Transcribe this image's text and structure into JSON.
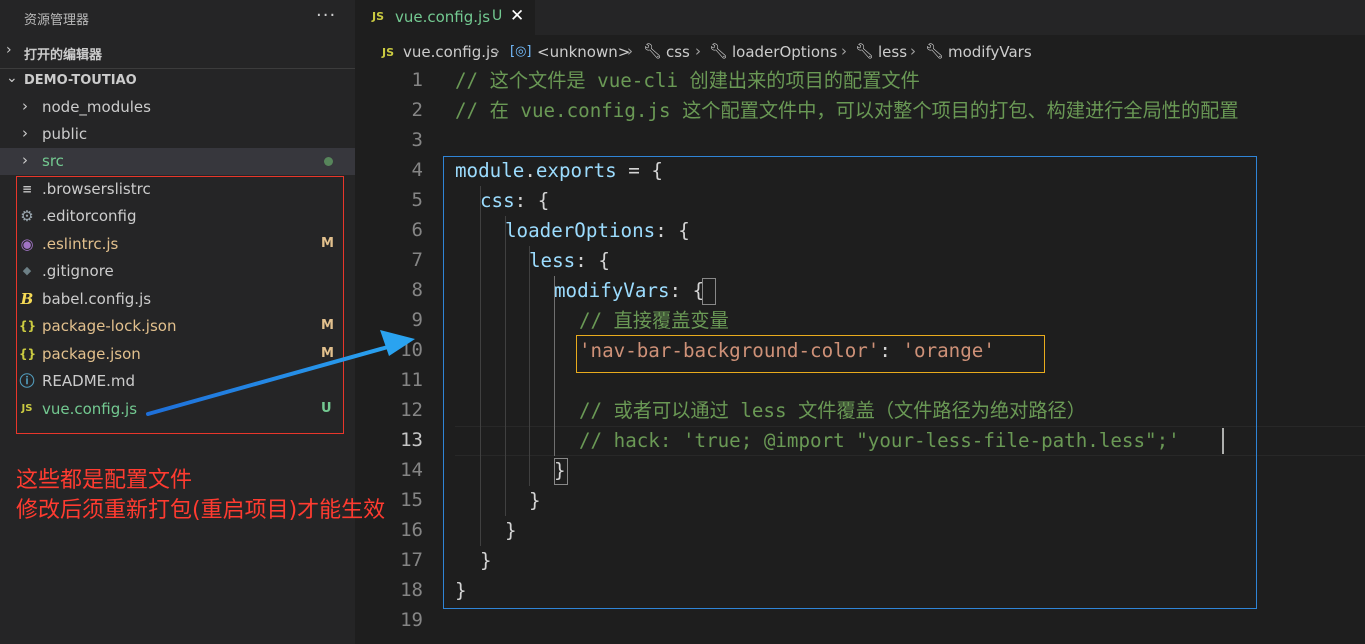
{
  "sidebar": {
    "title": "资源管理器",
    "more": "···",
    "open_editors": "打开的编辑器",
    "project": "DEMO-TOUTIAO",
    "folders": [
      {
        "name": "node_modules"
      },
      {
        "name": "public"
      },
      {
        "name": "src"
      }
    ],
    "files": [
      {
        "name": ".browserslistrc",
        "status": "",
        "icon": "lines-icon",
        "icon_glyph": "≡",
        "icon_color": "#c5c5c5"
      },
      {
        "name": ".editorconfig",
        "status": "",
        "icon": "gear-icon",
        "icon_glyph": "⚙",
        "icon_color": "#9aa7b0"
      },
      {
        "name": ".eslintrc.js",
        "status": "M",
        "icon": "eslint-icon",
        "icon_glyph": "◉",
        "icon_color": "#a074c4"
      },
      {
        "name": ".gitignore",
        "status": "",
        "icon": "git-icon",
        "icon_glyph": "◆",
        "icon_color": "#6d8086"
      },
      {
        "name": "babel.config.js",
        "status": "",
        "icon": "babel-icon",
        "icon_glyph": "B",
        "icon_color": "#f5da55"
      },
      {
        "name": "package-lock.json",
        "status": "M",
        "icon": "json-icon",
        "icon_glyph": "{}",
        "icon_color": "#cbcb41"
      },
      {
        "name": "package.json",
        "status": "M",
        "icon": "json-icon",
        "icon_glyph": "{}",
        "icon_color": "#cbcb41"
      },
      {
        "name": "README.md",
        "status": "",
        "icon": "info-icon",
        "icon_glyph": "ⓘ",
        "icon_color": "#519aba"
      },
      {
        "name": "vue.config.js",
        "status": "U",
        "icon": "js-icon",
        "icon_glyph": "JS",
        "icon_color": "#cbcb41"
      }
    ]
  },
  "annotation": {
    "line1": "这些都是配置文件",
    "line2": "修改后须重新打包(重启项目)才能生效"
  },
  "tab": {
    "badge": "JS",
    "name": "vue.config.js",
    "status": "U",
    "close": "✕"
  },
  "breadcrumb": {
    "file": "vue.config.js",
    "items": [
      "<unknown>",
      "css",
      "loaderOptions",
      "less",
      "modifyVars"
    ]
  },
  "editor": {
    "line_numbers": [
      "1",
      "2",
      "3",
      "4",
      "5",
      "6",
      "7",
      "8",
      "9",
      "10",
      "11",
      "12",
      "13",
      "14",
      "15",
      "16",
      "17",
      "18",
      "19"
    ],
    "current_line": "13",
    "code": {
      "l1": "// 这个文件是 vue-cli 创建出来的项目的配置文件",
      "l2": "// 在 vue.config.js 这个配置文件中，可以对整个项目的打包、构建进行全局性的配置",
      "l4a": "module",
      "l4b": ".",
      "l4c": "exports",
      "l4d": " = {",
      "l5a": "css",
      "l5b": ": {",
      "l6a": "loaderOptions",
      "l6b": ": {",
      "l7a": "less",
      "l7b": ": {",
      "l8a": "modifyVars",
      "l8b": ": {",
      "l9": "// 直接覆盖变量",
      "l10a": "'nav-bar-background-color'",
      "l10b": ": ",
      "l10c": "'orange'",
      "l12": "// 或者可以通过 less 文件覆盖（文件路径为绝对路径）",
      "l13": "// hack: 'true; @import \"your-less-file-path.less\";'",
      "l14": "}",
      "l15": "}",
      "l16": "}",
      "l17": "}",
      "l18": "}"
    }
  },
  "colors": {
    "accent_blue": "#2f84d6",
    "highlight_orange": "#e8ab1d",
    "annotation_red": "#ff3b30"
  }
}
